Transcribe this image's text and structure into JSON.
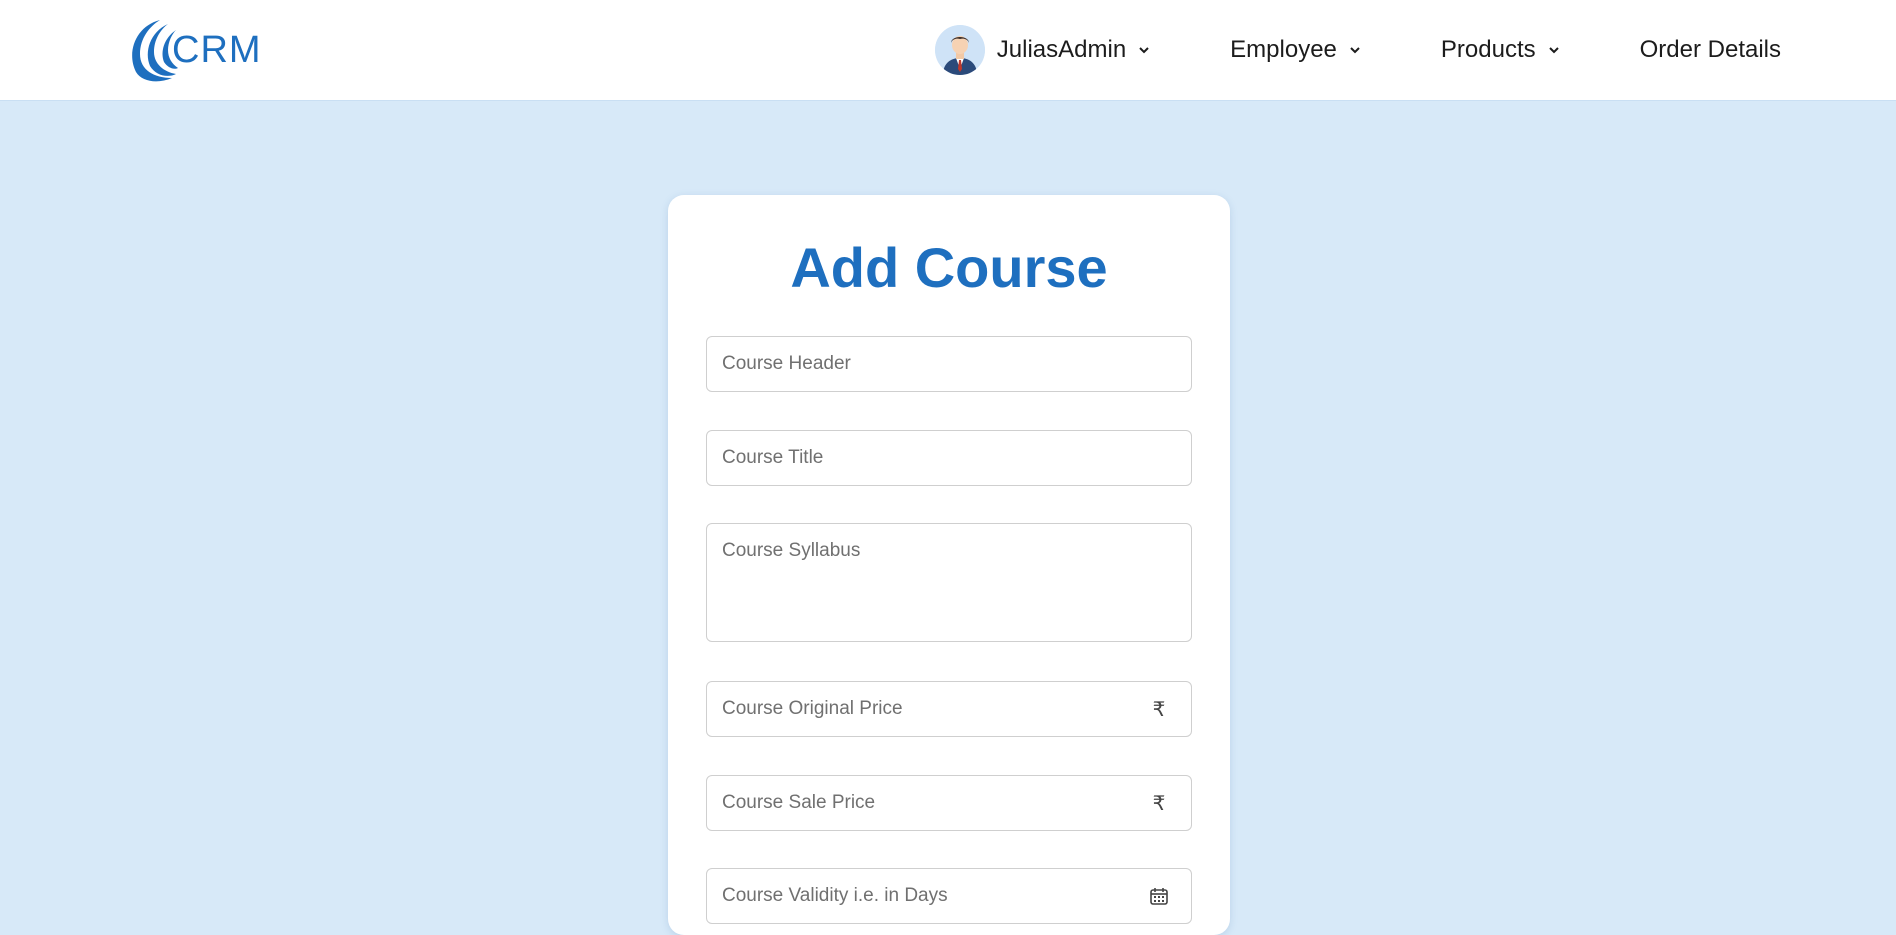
{
  "brand": {
    "logo_text": "CRM",
    "color": "#1e6fbf"
  },
  "nav": {
    "user": {
      "name": "JuliasAdmin",
      "avatar_icon": "person-avatar-icon"
    },
    "items": [
      {
        "label": "Employee",
        "has_dropdown": true
      },
      {
        "label": "Products",
        "has_dropdown": true
      },
      {
        "label": "Order Details",
        "has_dropdown": false
      }
    ]
  },
  "form": {
    "title": "Add Course",
    "fields": {
      "header": {
        "placeholder": "Course Header",
        "value": ""
      },
      "title": {
        "placeholder": "Course Title",
        "value": ""
      },
      "syllabus": {
        "placeholder": "Course Syllabus",
        "value": ""
      },
      "original_price": {
        "placeholder": "Course Original Price",
        "value": "",
        "icon": "rupee-icon",
        "icon_glyph": "₹"
      },
      "sale_price": {
        "placeholder": "Course Sale Price",
        "value": "",
        "icon": "rupee-icon",
        "icon_glyph": "₹"
      },
      "validity": {
        "placeholder": "Course Validity i.e. in Days",
        "value": "",
        "icon": "calendar-icon"
      }
    }
  },
  "colors": {
    "page_background": "#d7e9f8",
    "accent": "#1e6fbf",
    "card_background": "#ffffff"
  }
}
